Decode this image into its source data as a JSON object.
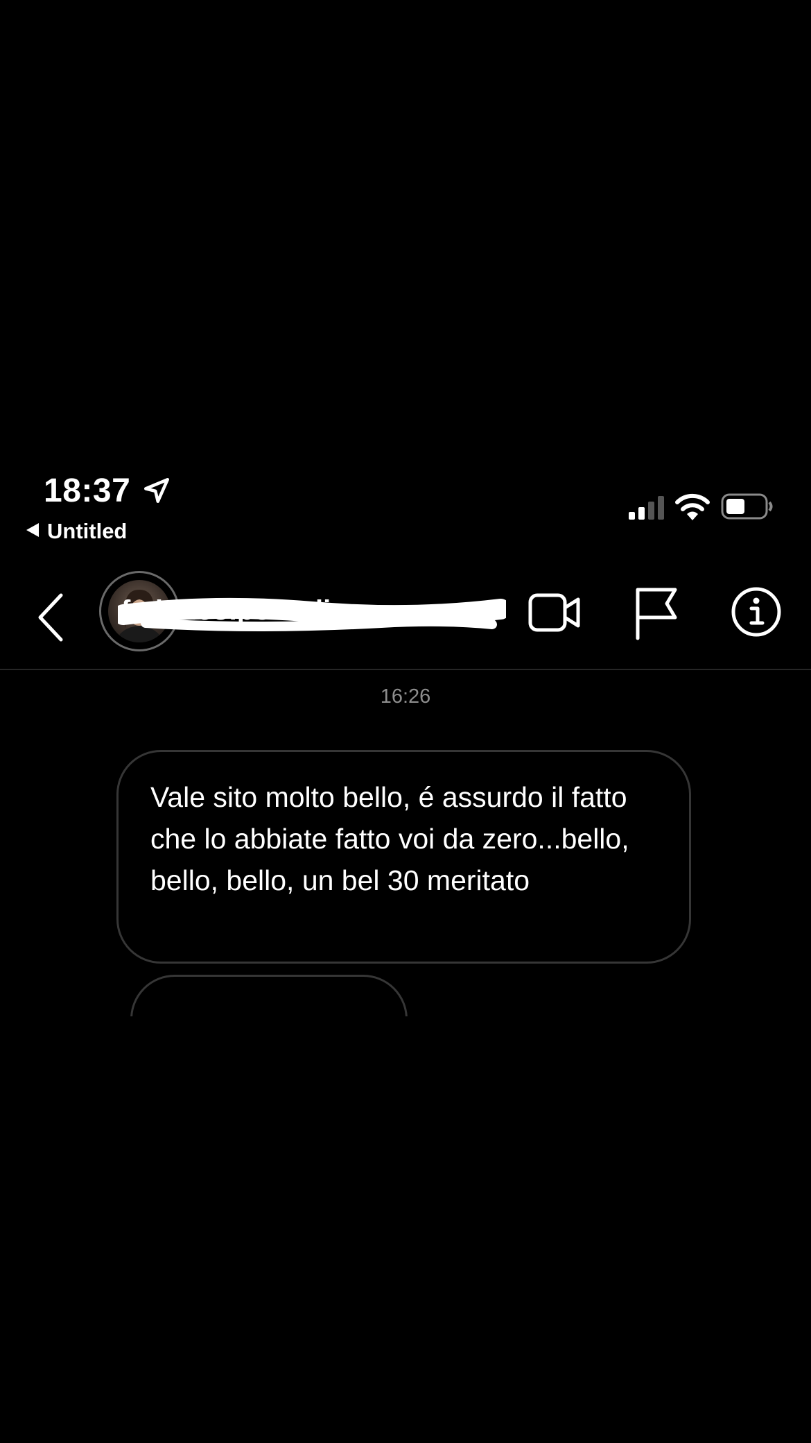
{
  "status_bar": {
    "time": "18:37",
    "back_app_label": "Untitled",
    "battery_level": 0.45,
    "signal_bars": 2
  },
  "header": {
    "contact_name": "federico.pozzoli"
  },
  "conversation": {
    "timestamp": "16:26",
    "messages": [
      {
        "text": "Vale sito molto bello, é assurdo il fatto che lo abbiate fatto voi da zero...bello, bello, bello, un bel 30 meritato"
      }
    ]
  },
  "icons": {
    "location": "location-arrow-icon",
    "signal": "signal-icon",
    "wifi": "wifi-icon",
    "battery": "battery-icon",
    "back": "chevron-left-icon",
    "video": "video-camera-icon",
    "flag": "flag-icon",
    "info": "info-icon"
  },
  "colors": {
    "background": "#000000",
    "text": "#ffffff",
    "muted": "#8e8e8e",
    "bubble_border": "#363636"
  }
}
